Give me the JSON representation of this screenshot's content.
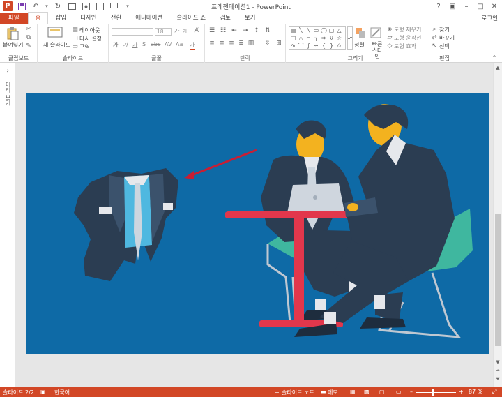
{
  "app": {
    "window_title": "프레젠테이션1 - PowerPoint",
    "login": "로그인",
    "logo_letter": "P"
  },
  "qat": {
    "save_icon": "save-icon",
    "undo_icon": "undo-icon",
    "redo_icon": "redo-icon"
  },
  "tabs": [
    "파일",
    "홈",
    "삽입",
    "디자인",
    "전환",
    "애니메이션",
    "슬라이드 쇼",
    "검토",
    "보기"
  ],
  "ribbon": {
    "clipboard": {
      "paste": "붙여넣기",
      "label": "클립보드"
    },
    "slides": {
      "new_slide": "새 슬라이드",
      "layout": "레이아웃",
      "reset": "다시 설정",
      "section": "구역",
      "label": "슬라이드"
    },
    "font": {
      "size": "18",
      "label": "글꼴",
      "bold": "가",
      "italic": "가",
      "underline": "가",
      "shadow": "S",
      "strike": "abc",
      "spacing": "AV",
      "case": "Aa",
      "color": "가",
      "grow": "가",
      "shrink": "가"
    },
    "paragraph": {
      "label": "단락"
    },
    "drawing": {
      "arrange": "정렬",
      "quick_styles": "빠른 스타일",
      "fill": "도형 채우기",
      "outline": "도형 윤곽선",
      "effects": "도형 효과",
      "label": "그리기"
    },
    "editing": {
      "find": "찾기",
      "replace": "바꾸기",
      "select": "선택",
      "label": "편집"
    }
  },
  "left_pane": {
    "collapsed_label": "미리 보기"
  },
  "status": {
    "slide": "슬라이드 2/2",
    "language": "한국어",
    "notes": "슬라이드 노트",
    "comments": "메모",
    "zoom": "87 %"
  },
  "colors": {
    "accent": "#d24726",
    "slide_bg": "#0e6aa6",
    "table_red": "#e2374c",
    "chair_teal": "#3fb79f"
  },
  "zoom_level": 87
}
